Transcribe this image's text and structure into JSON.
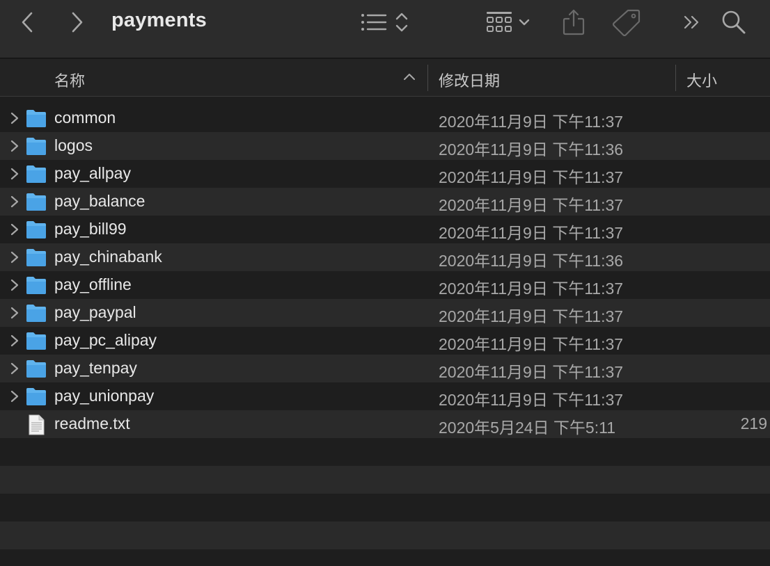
{
  "window": {
    "title": "payments"
  },
  "toolbar": {
    "back_icon": "chevron-left-icon",
    "forward_icon": "chevron-right-icon",
    "list_view_icon": "list-icon",
    "sort_icon": "up-down-chevrons-icon",
    "group_icon": "grid-icon",
    "share_icon": "share-icon",
    "tag_icon": "tag-icon",
    "more_icon": "double-chevron-icon",
    "search_icon": "search-icon"
  },
  "columns": {
    "name": "名称",
    "date": "修改日期",
    "size": "大小"
  },
  "files": [
    {
      "name": "common",
      "date": "2020年11月9日 下午11:37",
      "size": "",
      "kind": "folder"
    },
    {
      "name": "logos",
      "date": "2020年11月9日 下午11:36",
      "size": "",
      "kind": "folder"
    },
    {
      "name": "pay_allpay",
      "date": "2020年11月9日 下午11:37",
      "size": "",
      "kind": "folder"
    },
    {
      "name": "pay_balance",
      "date": "2020年11月9日 下午11:37",
      "size": "",
      "kind": "folder"
    },
    {
      "name": "pay_bill99",
      "date": "2020年11月9日 下午11:37",
      "size": "",
      "kind": "folder"
    },
    {
      "name": "pay_chinabank",
      "date": "2020年11月9日 下午11:36",
      "size": "",
      "kind": "folder"
    },
    {
      "name": "pay_offline",
      "date": "2020年11月9日 下午11:37",
      "size": "",
      "kind": "folder"
    },
    {
      "name": "pay_paypal",
      "date": "2020年11月9日 下午11:37",
      "size": "",
      "kind": "folder"
    },
    {
      "name": "pay_pc_alipay",
      "date": "2020年11月9日 下午11:37",
      "size": "",
      "kind": "folder"
    },
    {
      "name": "pay_tenpay",
      "date": "2020年11月9日 下午11:37",
      "size": "",
      "kind": "folder"
    },
    {
      "name": "pay_unionpay",
      "date": "2020年11月9日 下午11:37",
      "size": "",
      "kind": "folder"
    },
    {
      "name": "readme.txt",
      "date": "2020年5月24日 下午5:11",
      "size": "219",
      "kind": "text-file"
    }
  ],
  "colors": {
    "folder": "#5fb3ee",
    "background": "#1e1e1e",
    "alt_row": "#2a2a2a"
  }
}
